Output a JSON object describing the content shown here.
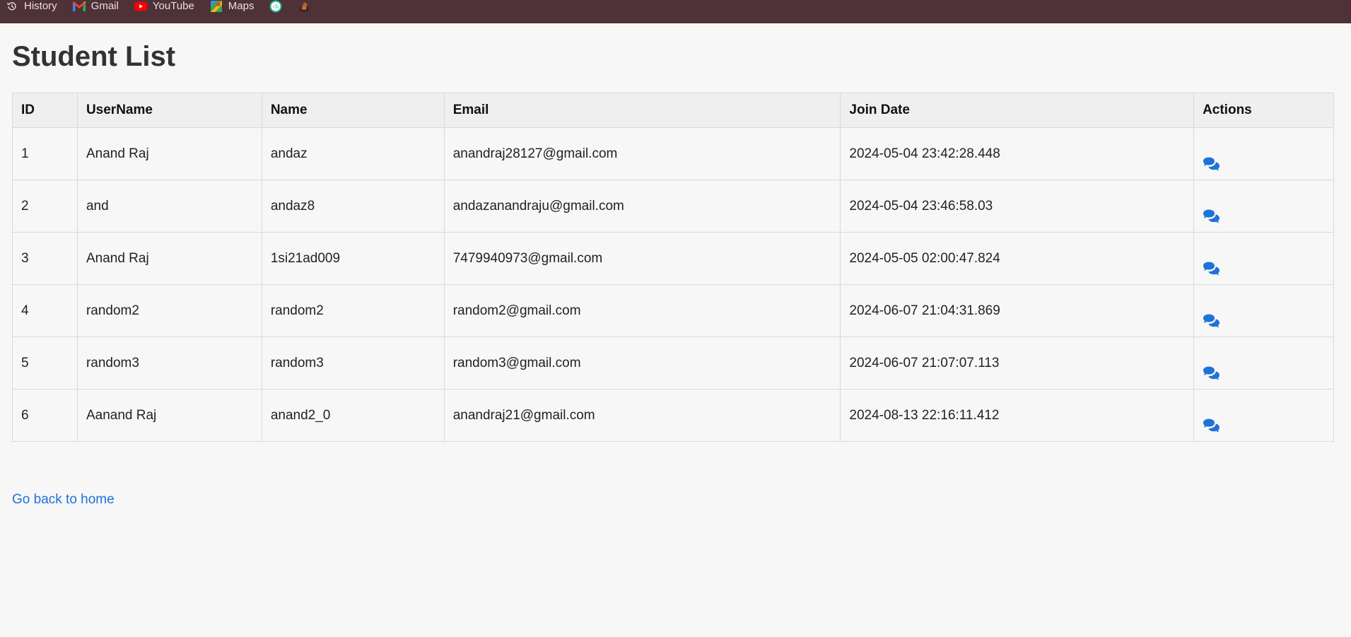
{
  "bookmarks": [
    {
      "label": "History",
      "icon": "history-icon"
    },
    {
      "label": "Gmail",
      "icon": "gmail-icon"
    },
    {
      "label": "YouTube",
      "icon": "youtube-icon"
    },
    {
      "label": "Maps",
      "icon": "maps-icon"
    },
    {
      "label": "",
      "icon": "cb-icon"
    },
    {
      "label": "",
      "icon": "stackoverflow-icon"
    }
  ],
  "page": {
    "title": "Student List",
    "home_link": "Go back to home"
  },
  "table": {
    "headers": [
      "ID",
      "UserName",
      "Name",
      "Email",
      "Join Date",
      "Actions"
    ],
    "rows": [
      {
        "id": "1",
        "username": "Anand Raj",
        "name": "andaz",
        "email": "anandraj28127@gmail.com",
        "join_date": "2024-05-04 23:42:28.448",
        "action_icon": "chat-icon"
      },
      {
        "id": "2",
        "username": "and",
        "name": "andaz8",
        "email": "andazanandraju@gmail.com",
        "join_date": "2024-05-04 23:46:58.03",
        "action_icon": "chat-icon"
      },
      {
        "id": "3",
        "username": "Anand Raj",
        "name": "1si21ad009",
        "email": "7479940973@gmail.com",
        "join_date": "2024-05-05 02:00:47.824",
        "action_icon": "chat-icon"
      },
      {
        "id": "4",
        "username": "random2",
        "name": "random2",
        "email": "random2@gmail.com",
        "join_date": "2024-06-07 21:04:31.869",
        "action_icon": "chat-icon"
      },
      {
        "id": "5",
        "username": "random3",
        "name": "random3",
        "email": "random3@gmail.com",
        "join_date": "2024-06-07 21:07:07.113",
        "action_icon": "chat-icon"
      },
      {
        "id": "6",
        "username": "Aanand Raj",
        "name": "anand2_0",
        "email": "anandraj21@gmail.com",
        "join_date": "2024-08-13 22:16:11.412",
        "action_icon": "chat-icon"
      }
    ]
  },
  "colors": {
    "bookmarks_bar": "#4f3138",
    "background": "#f7f7f7",
    "link": "#1e73d8",
    "icon": "#1e73d8"
  }
}
